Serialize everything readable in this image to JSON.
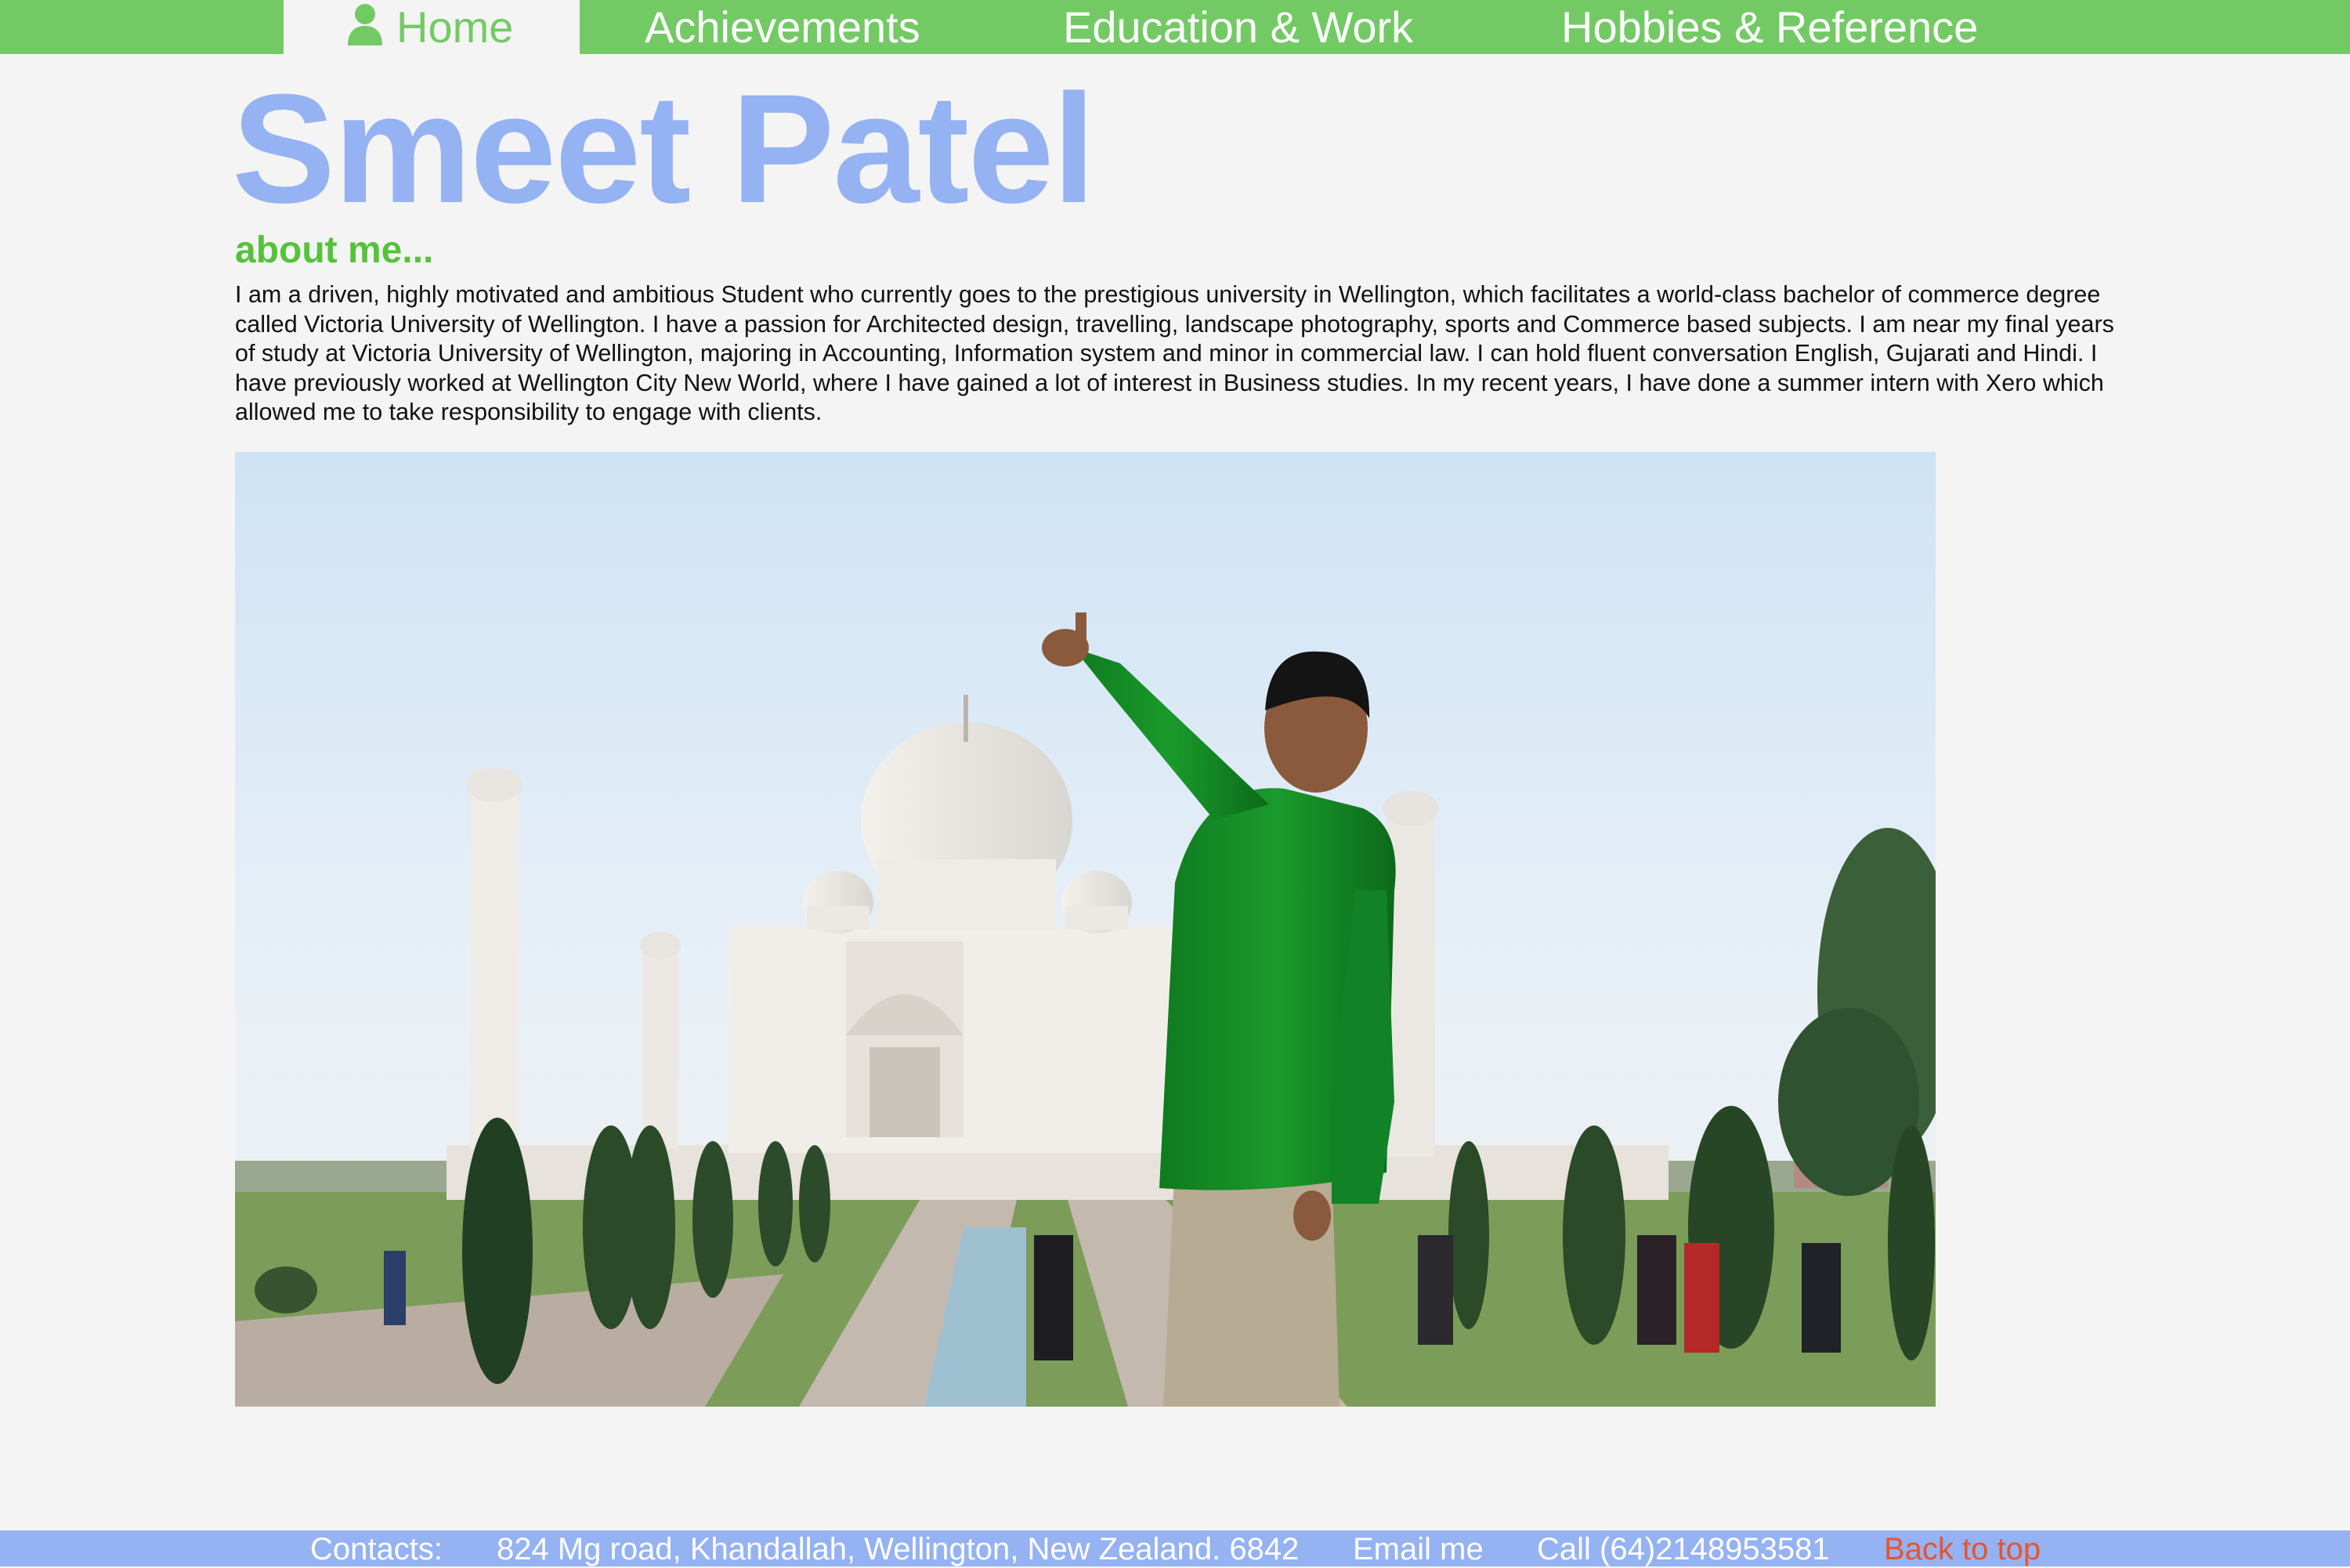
{
  "nav": {
    "items": [
      {
        "label": "Home",
        "icon": "user-icon",
        "active": true
      },
      {
        "label": "Achievements"
      },
      {
        "label": "Education & Work"
      },
      {
        "label": "Hobbies & Reference"
      }
    ]
  },
  "header": {
    "name": "Smeet Patel"
  },
  "about": {
    "title": "about me...",
    "text": "I am a driven, highly motivated and ambitious Student who currently goes to the prestigious university in Wellington, which facilitates a world-class bachelor of commerce degree called Victoria University of Wellington. I have a passion for Architected design, travelling, landscape photography, sports and Commerce based subjects. I am near my final years of study at Victoria University of Wellington, majoring in Accounting, Information system and minor in commercial law. I can hold fluent conversation English, Gujarati and Hindi. I have previously worked at Wellington City New World, where I have gained a lot of interest in Business studies. In my recent years, I have done a summer intern with Xero which allowed me to take responsibility to engage with clients."
  },
  "photo": {
    "subject": "man-in-green-shirt-at-taj-mahal"
  },
  "footer": {
    "contacts_label": "Contacts:",
    "address": "824 Mg road, Khandallah, Wellington, New Zealand. 6842",
    "email_label": "Email me",
    "call_label": "Call (64)2148953581",
    "back_to_top": "Back to top"
  },
  "colors": {
    "nav_green": "#73ca64",
    "name_blue": "#95b2f2",
    "about_green": "#54c33b",
    "footer_blue": "#95b2f2",
    "back_to_top": "#e8542e",
    "background": "#f4f4f4"
  }
}
